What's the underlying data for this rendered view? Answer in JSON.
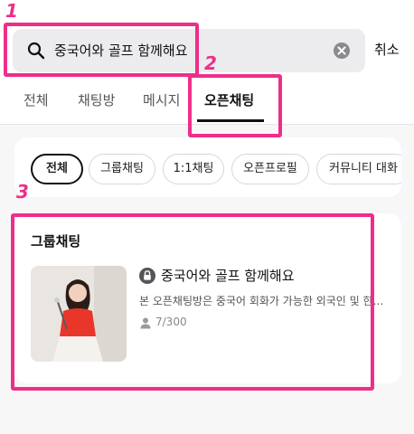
{
  "search": {
    "query": "중국어와 골프 함께해요"
  },
  "header": {
    "cancel_label": "취소"
  },
  "tabs": [
    {
      "label": "전체"
    },
    {
      "label": "채팅방"
    },
    {
      "label": "메시지"
    },
    {
      "label": "오픈채팅"
    }
  ],
  "filters": [
    {
      "label": "전체"
    },
    {
      "label": "그룹채팅"
    },
    {
      "label": "1:1채팅"
    },
    {
      "label": "오픈프로필"
    },
    {
      "label": "커뮤니티 대화"
    }
  ],
  "results": {
    "section_title": "그룹채팅",
    "room": {
      "title": "중국어와 골프 함께해요",
      "description": "본 오픈채팅방은 중국어 회화가 가능한 외국인 및 한…",
      "members": "7/300"
    }
  },
  "annotations": {
    "labels": [
      "1",
      "2",
      "3"
    ]
  },
  "colors": {
    "highlight": "#ee2e8a",
    "accent": "#111111"
  }
}
